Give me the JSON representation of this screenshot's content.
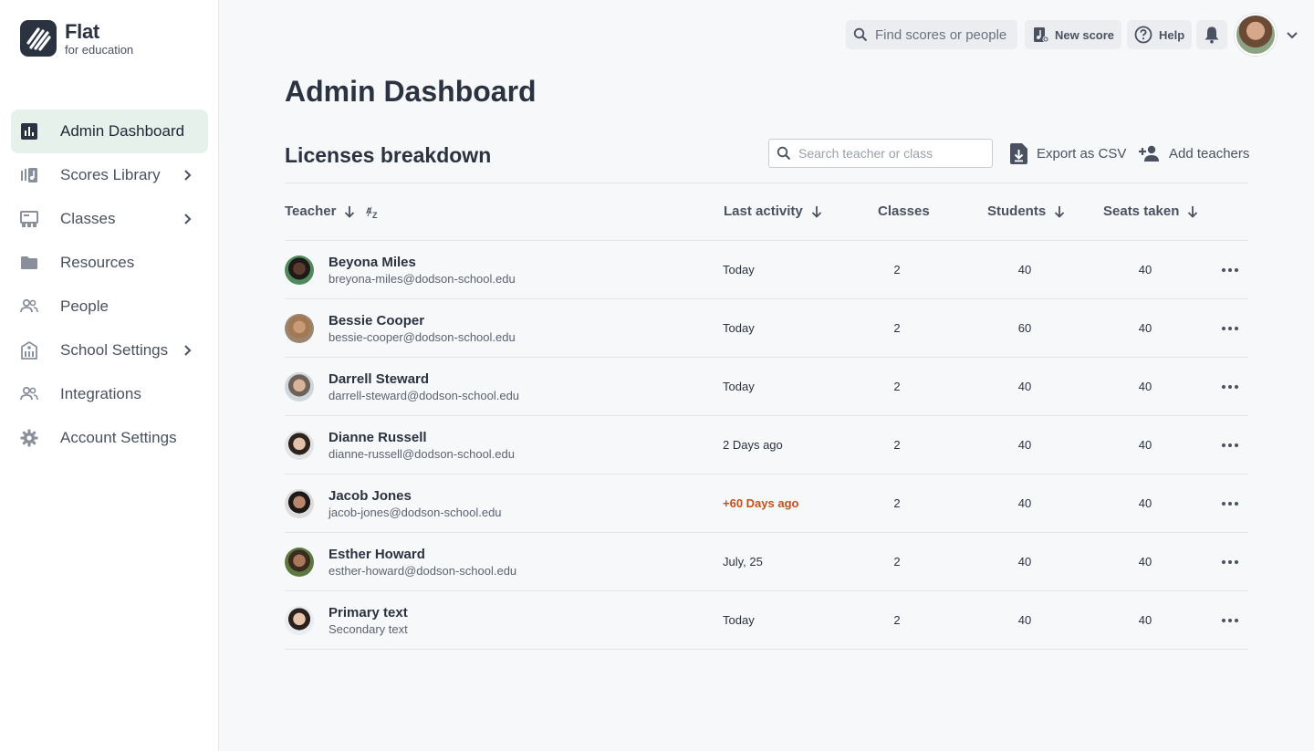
{
  "brand": {
    "name": "Flat",
    "tagline": "for education"
  },
  "sidebar": {
    "items": [
      {
        "label": "Admin Dashboard",
        "icon": "bar-chart-icon",
        "active": true,
        "has_chevron": false
      },
      {
        "label": "Scores Library",
        "icon": "library-icon",
        "active": false,
        "has_chevron": true
      },
      {
        "label": "Classes",
        "icon": "classes-icon",
        "active": false,
        "has_chevron": true
      },
      {
        "label": "Resources",
        "icon": "folder-icon",
        "active": false,
        "has_chevron": false
      },
      {
        "label": "People",
        "icon": "people-icon",
        "active": false,
        "has_chevron": false
      },
      {
        "label": "School Settings",
        "icon": "school-icon",
        "active": false,
        "has_chevron": true
      },
      {
        "label": "Integrations",
        "icon": "integrations-icon",
        "active": false,
        "has_chevron": false
      },
      {
        "label": "Account Settings",
        "icon": "gear-icon",
        "active": false,
        "has_chevron": false
      }
    ]
  },
  "topbar": {
    "search_placeholder": "Find scores or people",
    "new_score_label": "New score",
    "help_label": "Help"
  },
  "main": {
    "title": "Admin Dashboard",
    "section_title": "Licenses breakdown",
    "table_search_placeholder": "Search teacher or class",
    "export_label": "Export as CSV",
    "add_teachers_label": "Add teachers"
  },
  "table": {
    "columns": {
      "teacher": "Teacher",
      "last_activity": "Last activity",
      "classes": "Classes",
      "students": "Students",
      "seats": "Seats taken"
    },
    "rows": [
      {
        "name": "Beyona Miles",
        "email": "breyona-miles@dodson-school.edu",
        "activity": "Today",
        "classes": "2",
        "students": "40",
        "seats": "40"
      },
      {
        "name": "Bessie Cooper",
        "email": "bessie-cooper@dodson-school.edu",
        "activity": "Today",
        "classes": "2",
        "students": "60",
        "seats": "40"
      },
      {
        "name": "Darrell Steward",
        "email": "darrell-steward@dodson-school.edu",
        "activity": "Today",
        "classes": "2",
        "students": "40",
        "seats": "40"
      },
      {
        "name": "Dianne Russell",
        "email": "dianne-russell@dodson-school.edu",
        "activity": "2 Days ago",
        "classes": "2",
        "students": "40",
        "seats": "40"
      },
      {
        "name": "Jacob Jones",
        "email": "jacob-jones@dodson-school.edu",
        "activity": "+60 Days ago",
        "classes": "2",
        "students": "40",
        "seats": "40"
      },
      {
        "name": "Esther Howard",
        "email": "esther-howard@dodson-school.edu",
        "activity": "July, 25",
        "classes": "2",
        "students": "40",
        "seats": "40"
      },
      {
        "name": "Primary text",
        "email": "Secondary text",
        "activity": "Today",
        "classes": "2",
        "students": "40",
        "seats": "40"
      }
    ]
  },
  "colors": {
    "accent_bg": "#e7f1ec",
    "warning_text": "#c4501a",
    "text_primary": "#2b3240"
  }
}
